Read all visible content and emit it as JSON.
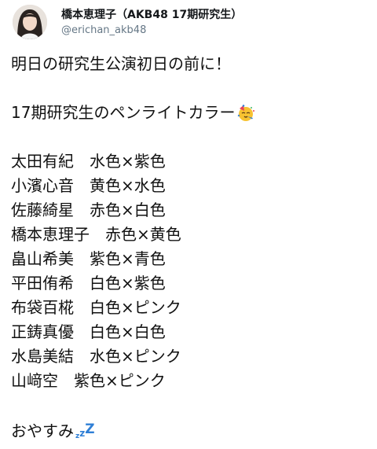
{
  "author": {
    "display_name": "橋本恵理子（AKB48 17期研究生）",
    "handle": "@erichan_akb48",
    "avatar_icon": "profile-photo"
  },
  "tweet": {
    "line1": "明日の研究生公演初日の前に！",
    "line2": "17期研究生のペンライトカラー",
    "line2_emoji": "party-face-icon",
    "members": [
      {
        "name": "太田有紀",
        "gap": "　",
        "colors": "水色×紫色"
      },
      {
        "name": "小濱心音",
        "gap": "　",
        "colors": "黄色×水色"
      },
      {
        "name": "佐藤綺星",
        "gap": "　",
        "colors": "赤色×白色"
      },
      {
        "name": "橋本恵理子",
        "gap": "　",
        "colors": "赤色×黄色"
      },
      {
        "name": "畠山希美",
        "gap": "　",
        "colors": "紫色×青色"
      },
      {
        "name": "平田侑希",
        "gap": "　",
        "colors": "白色×紫色"
      },
      {
        "name": "布袋百椛",
        "gap": "　",
        "colors": "白色×ピンク"
      },
      {
        "name": "正鋳真優",
        "gap": "　",
        "colors": "白色×白色"
      },
      {
        "name": "水島美結",
        "gap": "　",
        "colors": "水色×ピンク"
      },
      {
        "name": "山﨑空",
        "gap": "　",
        "colors": "紫色×ピンク"
      }
    ],
    "closing": "おやすみ",
    "closing_zzz": [
      "z",
      "z",
      "Z"
    ]
  },
  "colors": {
    "text": "#111111",
    "handle": "#657786",
    "zzz": "#2f7fd6"
  }
}
